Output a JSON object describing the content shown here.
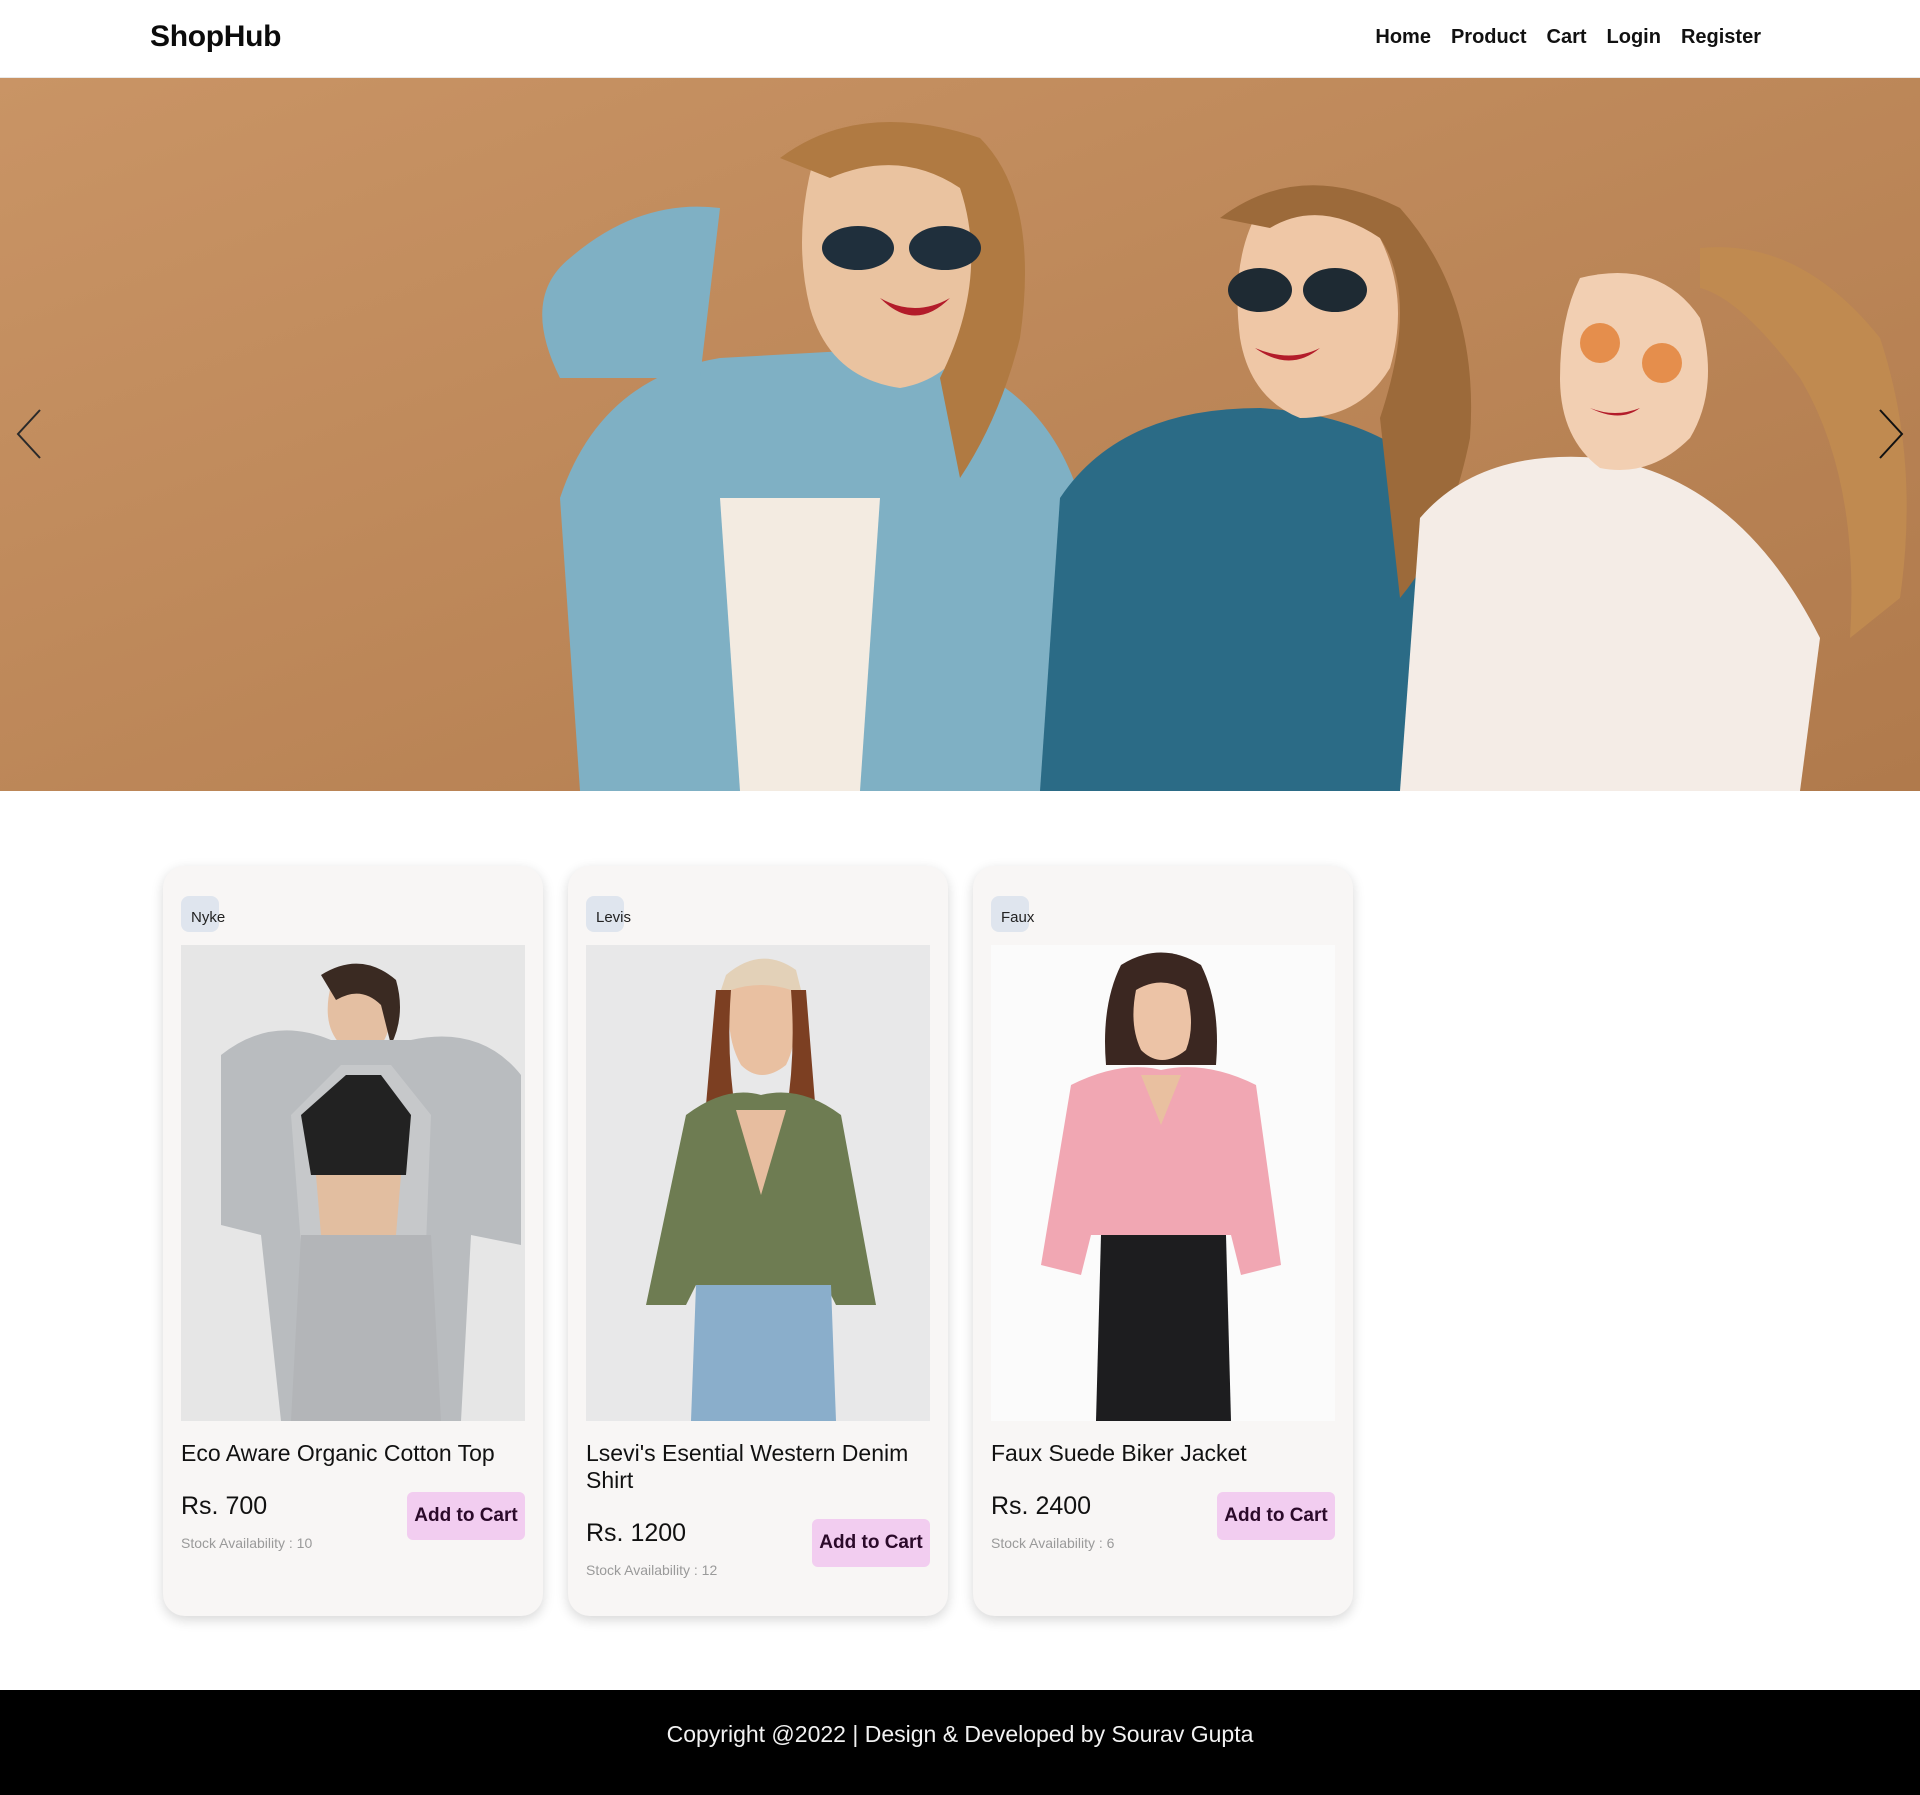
{
  "navbar": {
    "brand": "ShopHub",
    "links": [
      "Home",
      "Product",
      "Cart",
      "Login",
      "Register"
    ]
  },
  "hero": {
    "prev_icon": "chevron-left-icon",
    "next_icon": "chevron-right-icon",
    "background_color": "#c08a5b"
  },
  "products": [
    {
      "brand": "Nyke",
      "title": "Eco Aware Organic Cotton Top",
      "price": "Rs. 700",
      "stock": "Stock Availability : 10",
      "button": "Add to Cart"
    },
    {
      "brand": "Levis",
      "title": "Lsevi's Esential Western Denim Shirt",
      "price": "Rs. 1200",
      "stock": "Stock Availability : 12",
      "button": "Add to Cart"
    },
    {
      "brand": "Faux",
      "title": "Faux Suede Biker Jacket",
      "price": "Rs. 2400",
      "stock": "Stock Availability : 6",
      "button": "Add to Cart"
    }
  ],
  "footer": {
    "text": "Copyright @2022 | Design & Developed by Sourav Gupta"
  },
  "colors": {
    "button_bg": "#f2cdf0",
    "tag_bg": "#dfe5ee",
    "card_bg": "#f8f6f5",
    "footer_bg": "#000000"
  }
}
